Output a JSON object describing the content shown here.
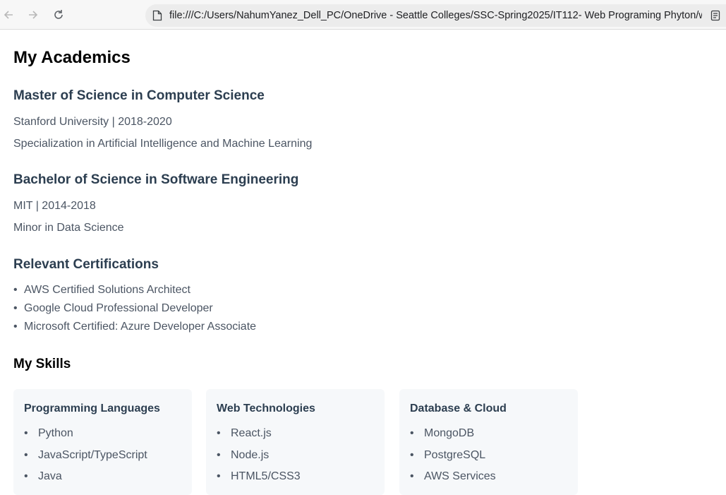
{
  "browser": {
    "url": "file:///C:/Users/NahumYanez_Dell_PC/OneDrive - Seattle Colleges/SSC-Spring2025/IT112- Web Programing Phyton/week7/h",
    "icons": {
      "back": "arrow-left-icon",
      "forward": "arrow-right-icon",
      "reload": "reload-icon",
      "page": "file-icon",
      "reader": "reader-view-icon"
    }
  },
  "page": {
    "title": "My Academics",
    "degrees": [
      {
        "title": "Master of Science in Computer Science",
        "school": "Stanford University | 2018-2020",
        "detail": "Specialization in Artificial Intelligence and Machine Learning"
      },
      {
        "title": "Bachelor of Science in Software Engineering",
        "school": "MIT | 2014-2018",
        "detail": "Minor in Data Science"
      }
    ],
    "certifications": {
      "title": "Relevant Certifications",
      "items": [
        "AWS Certified Solutions Architect",
        "Google Cloud Professional Developer",
        "Microsoft Certified: Azure Developer Associate"
      ]
    },
    "skills": {
      "title": "My Skills",
      "cards": [
        {
          "title": "Programming Languages",
          "items": [
            "Python",
            "JavaScript/TypeScript",
            "Java"
          ]
        },
        {
          "title": "Web Technologies",
          "items": [
            "React.js",
            "Node.js",
            "HTML5/CSS3"
          ]
        },
        {
          "title": "Database & Cloud",
          "items": [
            "MongoDB",
            "PostgreSQL",
            "AWS Services"
          ]
        }
      ]
    }
  }
}
